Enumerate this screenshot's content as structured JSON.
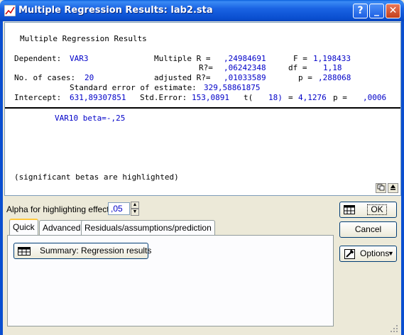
{
  "window": {
    "title": "Multiple Regression Results: lab2.sta",
    "help_label": "?",
    "minimize_label": "_",
    "close_label": "✕"
  },
  "results": {
    "heading": "Multiple Regression Results",
    "dependent_label": "Dependent:",
    "dependent_value": "VAR3",
    "multiple_r_label": "Multiple R =",
    "multiple_r_value": ",24984691",
    "f_label": "F =",
    "f_value": "1,198433",
    "r2_label": "R?=",
    "r2_value": ",06242348",
    "df_label": "df =",
    "df_value": "1,18",
    "cases_label": "No. of cases:",
    "cases_value": "20",
    "adj_r2_label": "adjusted R?=",
    "adj_r2_value": ",01033589",
    "p_label": "p =",
    "p_value": ",288068",
    "std_err_est_label": "Standard error of estimate:",
    "std_err_est_value": "329,58861875",
    "intercept_label": "Intercept:",
    "intercept_value": "631,89307851",
    "std_error_label": "Std.Error:",
    "std_error_value": "153,0891",
    "t_label": "t(",
    "t_df": "18)",
    "t_eq": "=",
    "t_value": "4,1276",
    "p2_label": "p =",
    "p2_value": ",0006",
    "beta_line": "VAR10 beta=-,25",
    "footnote": "(significant betas are highlighted)"
  },
  "controls": {
    "alpha_label": "Alpha for highlighting effects:",
    "alpha_value": ",05",
    "tabs": [
      {
        "label": "Quick"
      },
      {
        "label": "Advanced"
      },
      {
        "label": "Residuals/assumptions/prediction"
      }
    ],
    "summary_button": "Summary:  Regression results",
    "ok_label": "OK",
    "cancel_label": "Cancel",
    "options_label": "Options"
  },
  "colors": {
    "titlebar": "#0a4fd0",
    "value_blue": "#0000c8",
    "dialog_bg": "#ece9d8"
  }
}
